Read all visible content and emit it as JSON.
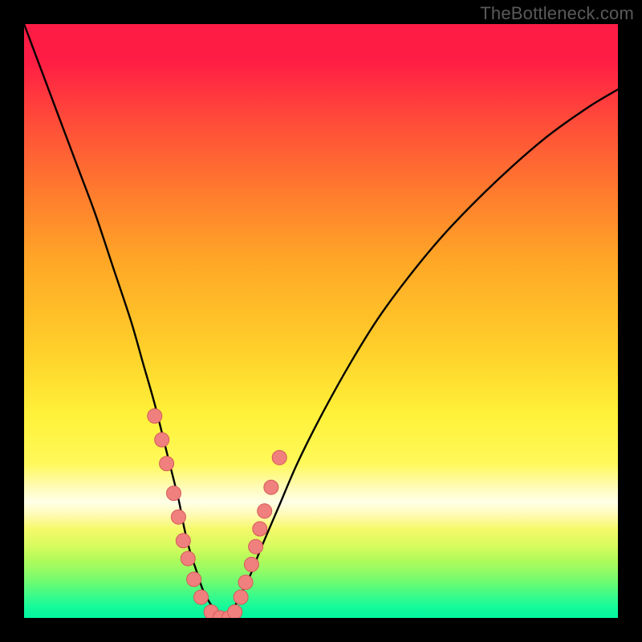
{
  "watermark": "TheBottleneck.com",
  "colors": {
    "frame": "#000000",
    "curve": "#000000",
    "marker_fill": "#f0807e",
    "marker_stroke": "#d55a58"
  },
  "chart_data": {
    "type": "line",
    "title": "",
    "xlabel": "",
    "ylabel": "",
    "xlim": [
      0,
      100
    ],
    "ylim": [
      0,
      100
    ],
    "grid": false,
    "legend": false,
    "note": "Bottleneck-style curve. X = relative GPU/CPU power (arbitrary 0-100). Y = bottleneck severity percent (0 at optimum, 100 at extreme). Values estimated from pixel positions; no axis ticks are rendered in the image.",
    "series": [
      {
        "name": "bottleneck_curve",
        "x": [
          0,
          3,
          6,
          9,
          12,
          15,
          18,
          20,
          22,
          24,
          26,
          27,
          28,
          29,
          30,
          31,
          32,
          33.5,
          34,
          35,
          36,
          38,
          40,
          43,
          46,
          50,
          55,
          60,
          66,
          72,
          80,
          88,
          95,
          100
        ],
        "y": [
          100,
          92,
          84,
          76,
          68,
          59,
          50,
          43,
          36,
          28,
          20,
          15,
          11,
          8,
          5,
          3,
          1.5,
          0,
          0,
          1,
          3,
          7,
          12,
          19,
          26,
          34,
          43,
          51,
          59,
          66,
          74,
          81,
          86,
          89
        ]
      }
    ],
    "markers": {
      "name": "highlighted_points",
      "note": "Pink dot markers clustered near the optimum dip.",
      "x": [
        22.0,
        23.2,
        24.0,
        25.2,
        26.0,
        26.8,
        27.6,
        28.6,
        29.8,
        31.5,
        33.0,
        34.5,
        35.5,
        36.5,
        37.3,
        38.3,
        39.0,
        39.7,
        40.5,
        41.6,
        43.0
      ],
      "y": [
        34.0,
        30.0,
        26.0,
        21.0,
        17.0,
        13.0,
        10.0,
        6.5,
        3.5,
        1.0,
        0.0,
        0.0,
        1.0,
        3.5,
        6.0,
        9.0,
        12.0,
        15.0,
        18.0,
        22.0,
        27.0
      ]
    }
  }
}
